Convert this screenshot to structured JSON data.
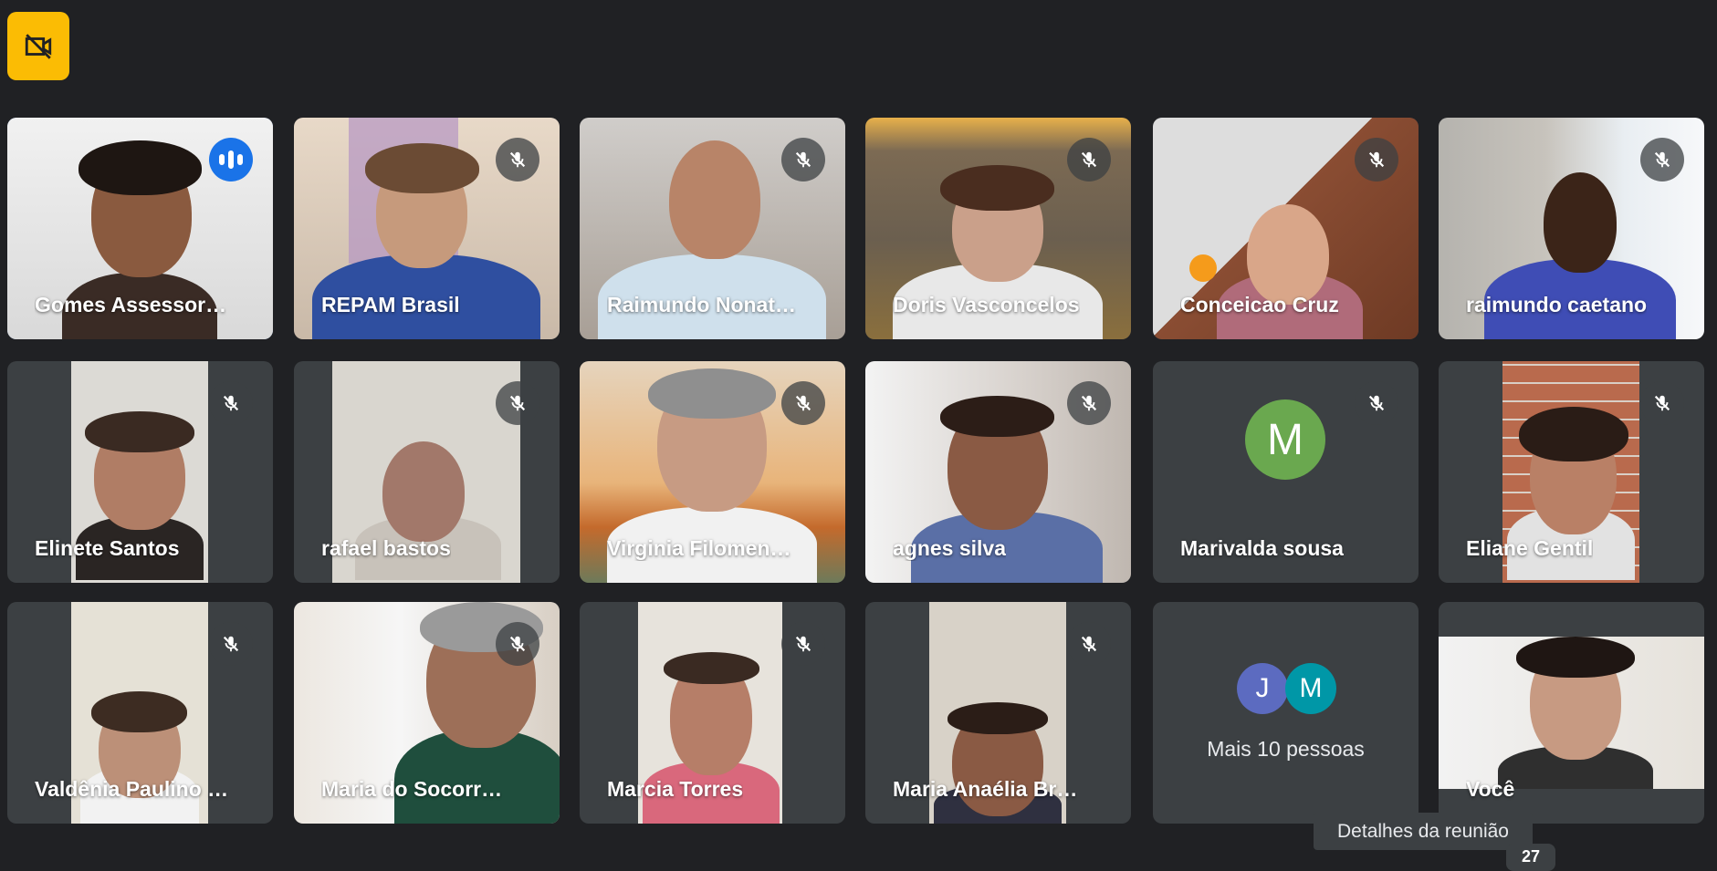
{
  "meeting": {
    "top_icon": "no-video-icon",
    "accent": "#fbbc04",
    "speaking_color": "#1a73e8",
    "participants": [
      {
        "name": "Gomes Assessor…",
        "status": "speaking"
      },
      {
        "name": "REPAM Brasil",
        "status": "muted"
      },
      {
        "name": "Raimundo Nonat…",
        "status": "muted"
      },
      {
        "name": "Doris Vasconcelos",
        "status": "muted"
      },
      {
        "name": "Conceicao Cruz",
        "status": "muted"
      },
      {
        "name": "raimundo caetano",
        "status": "muted"
      },
      {
        "name": "Elinete Santos",
        "status": "muted"
      },
      {
        "name": "rafael bastos",
        "status": "muted"
      },
      {
        "name": "Virginia Filomen…",
        "status": "muted"
      },
      {
        "name": "agnes silva",
        "status": "muted"
      },
      {
        "name": "Marivalda sousa",
        "status": "muted",
        "avatar_letter": "M",
        "avatar_color": "#6aa84f"
      },
      {
        "name": "Eliane Gentil",
        "status": "muted"
      },
      {
        "name": "Valdênia Paulino …",
        "status": "muted"
      },
      {
        "name": "Maria do Socorr…",
        "status": "muted"
      },
      {
        "name": "Marcia Torres",
        "status": "muted"
      },
      {
        "name": "Maria Anaélia Br…",
        "status": "muted"
      }
    ],
    "more_people": {
      "label": "Mais 10 pessoas",
      "avatars": [
        {
          "letter": "J",
          "color": "#5c6bc0"
        },
        {
          "letter": "M",
          "color": "#0097a7"
        }
      ]
    },
    "self": {
      "name": "Você"
    },
    "tooltip": "Detalhes da reunião",
    "counter": "27"
  }
}
